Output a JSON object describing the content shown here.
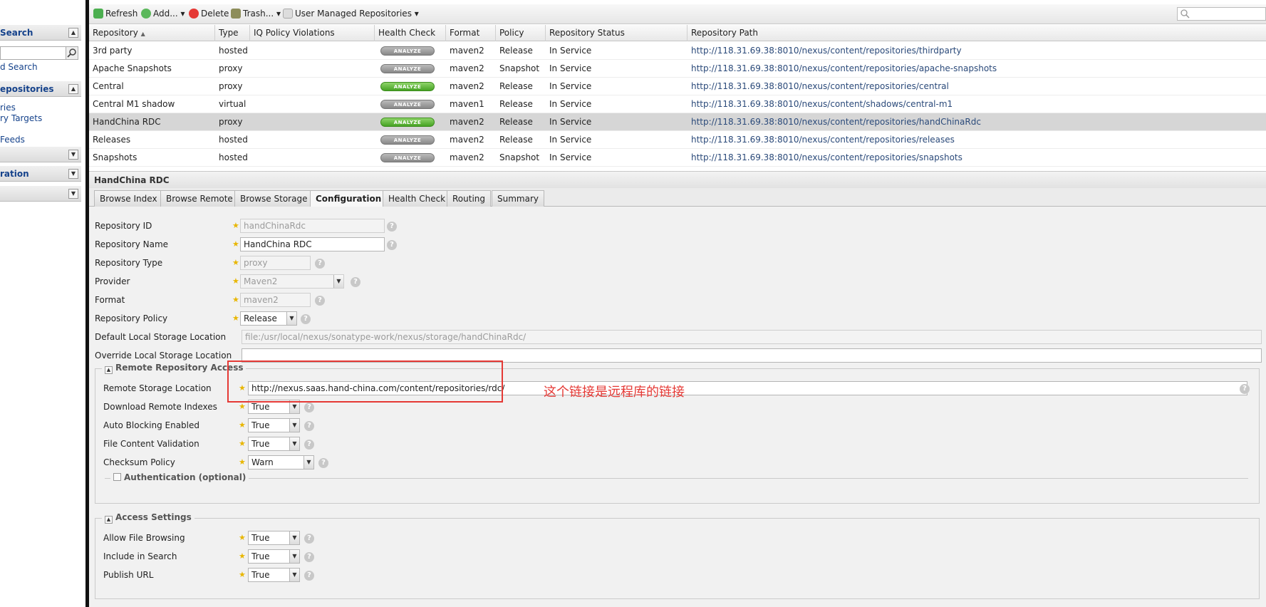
{
  "sidebar": {
    "search_panel": "Search",
    "advanced_search": "d Search",
    "repositories_panel": "epositories",
    "link_repositories": "ries",
    "link_repo_targets": "ry Targets",
    "link_feeds": "Feeds",
    "configuration_panel": "ration"
  },
  "toolbar": {
    "refresh": "Refresh",
    "add": "Add...",
    "delete": "Delete",
    "trash": "Trash...",
    "user_managed": "User Managed Repositories"
  },
  "grid": {
    "columns": [
      "Repository",
      "Type",
      "IQ Policy Violations",
      "Health Check",
      "Format",
      "Policy",
      "Repository Status",
      "Repository Path"
    ],
    "sort_indicator": "▲",
    "analyze_label": "ANALYZE",
    "rows": [
      {
        "name": "3rd party",
        "type": "hosted",
        "health": "grey",
        "format": "maven2",
        "policy": "Release",
        "status": "In Service",
        "path": "http://118.31.69.38:8010/nexus/content/repositories/thirdparty"
      },
      {
        "name": "Apache Snapshots",
        "type": "proxy",
        "health": "grey",
        "format": "maven2",
        "policy": "Snapshot",
        "status": "In Service",
        "path": "http://118.31.69.38:8010/nexus/content/repositories/apache-snapshots"
      },
      {
        "name": "Central",
        "type": "proxy",
        "health": "green",
        "format": "maven2",
        "policy": "Release",
        "status": "In Service",
        "path": "http://118.31.69.38:8010/nexus/content/repositories/central"
      },
      {
        "name": "Central M1 shadow",
        "type": "virtual",
        "health": "grey",
        "format": "maven1",
        "policy": "Release",
        "status": "In Service",
        "path": "http://118.31.69.38:8010/nexus/content/shadows/central-m1"
      },
      {
        "name": "HandChina RDC",
        "type": "proxy",
        "health": "green",
        "format": "maven2",
        "policy": "Release",
        "status": "In Service",
        "path": "http://118.31.69.38:8010/nexus/content/repositories/handChinaRdc"
      },
      {
        "name": "Releases",
        "type": "hosted",
        "health": "grey",
        "format": "maven2",
        "policy": "Release",
        "status": "In Service",
        "path": "http://118.31.69.38:8010/nexus/content/repositories/releases"
      },
      {
        "name": "Snapshots",
        "type": "hosted",
        "health": "grey",
        "format": "maven2",
        "policy": "Snapshot",
        "status": "In Service",
        "path": "http://118.31.69.38:8010/nexus/content/repositories/snapshots"
      }
    ]
  },
  "detail": {
    "title": "HandChina RDC",
    "tabs": [
      "Browse Index",
      "Browse Remote",
      "Browse Storage",
      "Configuration",
      "Health Check",
      "Routing",
      "Summary"
    ],
    "active_tab": "Configuration",
    "fields": {
      "repo_id_label": "Repository ID",
      "repo_id": "handChinaRdc",
      "repo_name_label": "Repository Name",
      "repo_name": "HandChina RDC",
      "repo_type_label": "Repository Type",
      "repo_type": "proxy",
      "provider_label": "Provider",
      "provider": "Maven2",
      "format_label": "Format",
      "format": "maven2",
      "policy_label": "Repository Policy",
      "policy": "Release",
      "default_storage_label": "Default Local Storage Location",
      "default_storage": "file:/usr/local/nexus/sonatype-work/nexus/storage/handChinaRdc/",
      "override_storage_label": "Override Local Storage Location",
      "override_storage": ""
    },
    "remote": {
      "legend": "Remote Repository Access",
      "location_label": "Remote Storage Location",
      "location": "http://nexus.saas.hand-china.com/content/repositories/rdc/",
      "download_indexes_label": "Download Remote Indexes",
      "download_indexes": "True",
      "auto_blocking_label": "Auto Blocking Enabled",
      "auto_blocking": "True",
      "file_validation_label": "File Content Validation",
      "file_validation": "True",
      "checksum_label": "Checksum Policy",
      "checksum": "Warn",
      "auth_legend": "Authentication (optional)"
    },
    "access": {
      "legend": "Access Settings",
      "browsing_label": "Allow File Browsing",
      "browsing": "True",
      "include_search_label": "Include in Search",
      "include_search": "True",
      "publish_url_label": "Publish URL",
      "publish_url": "True"
    },
    "annotation": "这个链接是远程库的链接"
  },
  "colors": {
    "highlight": "#e53935",
    "accent": "#15428b",
    "selected_row": "#d6d6d6"
  }
}
